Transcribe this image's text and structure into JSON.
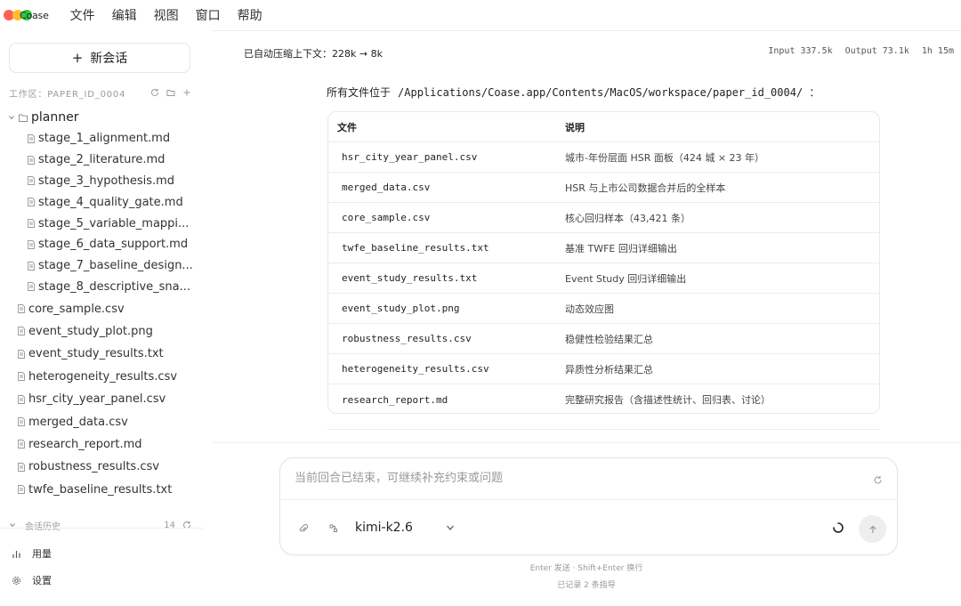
{
  "app": {
    "name": "Coase",
    "menu": [
      "文件",
      "编辑",
      "视图",
      "窗口",
      "帮助"
    ]
  },
  "sidebar": {
    "new_chat_label": "新会话",
    "workspace_label": "工作区：PAPER_ID_0004",
    "folder": {
      "name": "planner",
      "files": [
        "stage_1_alignment.md",
        "stage_2_literature.md",
        "stage_3_hypothesis.md",
        "stage_4_quality_gate.md",
        "stage_5_variable_mappi...",
        "stage_6_data_support.md",
        "stage_7_baseline_design...",
        "stage_8_descriptive_sna..."
      ]
    },
    "files": [
      "core_sample.csv",
      "event_study_plot.png",
      "event_study_results.txt",
      "heterogeneity_results.csv",
      "hsr_city_year_panel.csv",
      "merged_data.csv",
      "research_report.md",
      "robustness_results.csv",
      "twfe_baseline_results.txt"
    ],
    "history_label": "会话历史",
    "history_count": "14",
    "usage_label": "用量",
    "settings_label": "设置"
  },
  "main": {
    "compress_note": "已自动压缩上下文：228k → 8k",
    "stats": {
      "input": "Input 337.5k",
      "output": "Output 73.1k",
      "duration": "1h 15m"
    },
    "path_prefix": "所有文件位于",
    "path": "/Applications/Coase.app/Contents/MacOS/workspace/paper_id_0004/ ：",
    "table": {
      "headers": [
        "文件",
        "说明"
      ],
      "rows": [
        {
          "file": "hsr_city_year_panel.csv",
          "desc": "城市-年份层面 HSR 面板（424 城 × 23 年）"
        },
        {
          "file": "merged_data.csv",
          "desc": "HSR 与上市公司数据合并后的全样本"
        },
        {
          "file": "core_sample.csv",
          "desc": "核心回归样本（43,421 条）"
        },
        {
          "file": "twfe_baseline_results.txt",
          "desc": "基准 TWFE 回归详细输出"
        },
        {
          "file": "event_study_results.txt",
          "desc": "Event Study 回归详细输出"
        },
        {
          "file": "event_study_plot.png",
          "desc": "动态效应图"
        },
        {
          "file": "robustness_results.csv",
          "desc": "稳健性检验结果汇总"
        },
        {
          "file": "heterogeneity_results.csv",
          "desc": "异质性分析结果汇总"
        },
        {
          "file": "research_report.md",
          "desc": "完整研究报告（含描述性统计、回归表、讨论）"
        }
      ]
    },
    "composer": {
      "placeholder": "当前回合已结束，可继续补充约束或问题",
      "model": "kimi-k2.6"
    },
    "hint_send": "Enter 发送 · Shift+Enter 换行",
    "hint_recorded": "已记录 2 条指导"
  },
  "colors": {
    "traffic_red": "#ff5f57",
    "traffic_yellow": "#febc2e",
    "traffic_green": "#28c840",
    "border": "#e8e8e8"
  }
}
